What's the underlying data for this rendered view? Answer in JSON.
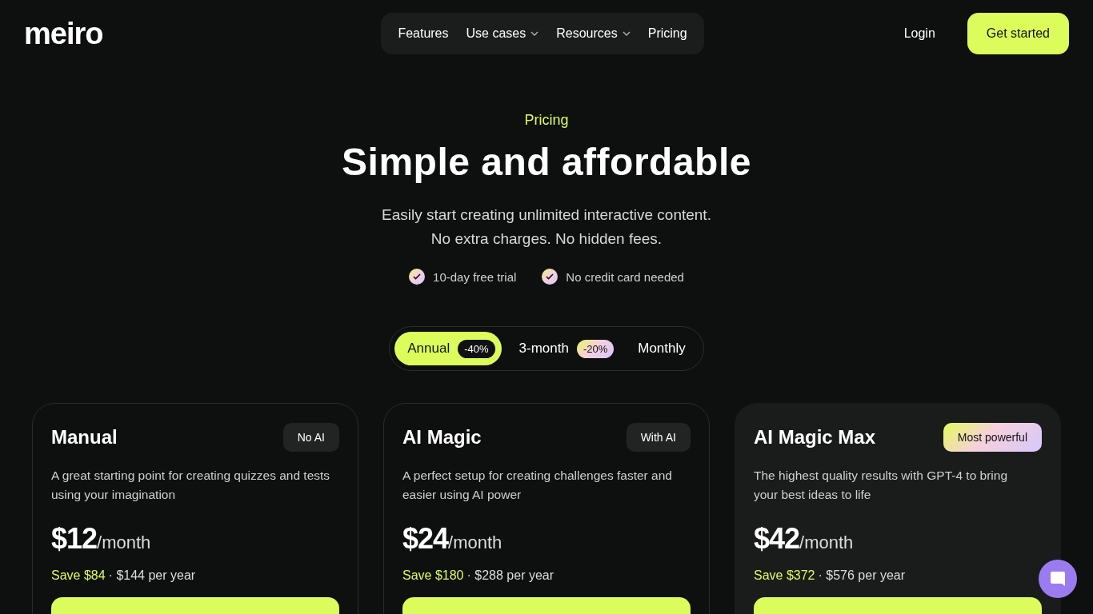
{
  "logo": "meiro",
  "nav": {
    "items": [
      {
        "label": "Features",
        "has_menu": false
      },
      {
        "label": "Use cases",
        "has_menu": true
      },
      {
        "label": "Resources",
        "has_menu": true
      },
      {
        "label": "Pricing",
        "has_menu": false
      }
    ],
    "login": "Login",
    "cta": "Get started"
  },
  "hero": {
    "eyebrow": "Pricing",
    "title": "Simple and affordable",
    "subtitle": [
      "Easily start creating unlimited interactive content.",
      "No extra charges. No hidden fees."
    ],
    "perks": [
      "10-day free trial",
      "No credit card needed"
    ]
  },
  "billing": [
    {
      "label": "Annual",
      "discount": "-40%",
      "selected": true
    },
    {
      "label": "3-month",
      "discount": "-20%",
      "selected": false
    },
    {
      "label": "Monthly",
      "selected": false
    }
  ],
  "plans": [
    {
      "name": "Manual",
      "badge": {
        "label": "No AI",
        "kind": "plain"
      },
      "featured": false,
      "description": "A great starting point for creating quizzes and tests using your imagination",
      "price": "$12",
      "period": "/month",
      "save": "Save $84",
      "yearly": "· $144 per year"
    },
    {
      "name": "AI Magic",
      "badge": {
        "label": "With AI",
        "kind": "plain"
      },
      "featured": false,
      "description": "A perfect setup for creating challenges faster and easier using AI power",
      "price": "$24",
      "period": "/month",
      "save": "Save $180",
      "yearly": "· $288 per year"
    },
    {
      "name": "AI Magic Max",
      "badge": {
        "label": "Most powerful",
        "kind": "gradient"
      },
      "featured": true,
      "description": "The highest quality results with GPT-4 to bring your best ideas to life",
      "price": "$42",
      "period": "/month",
      "save": "Save $372",
      "yearly": "· $576 per year"
    }
  ]
}
